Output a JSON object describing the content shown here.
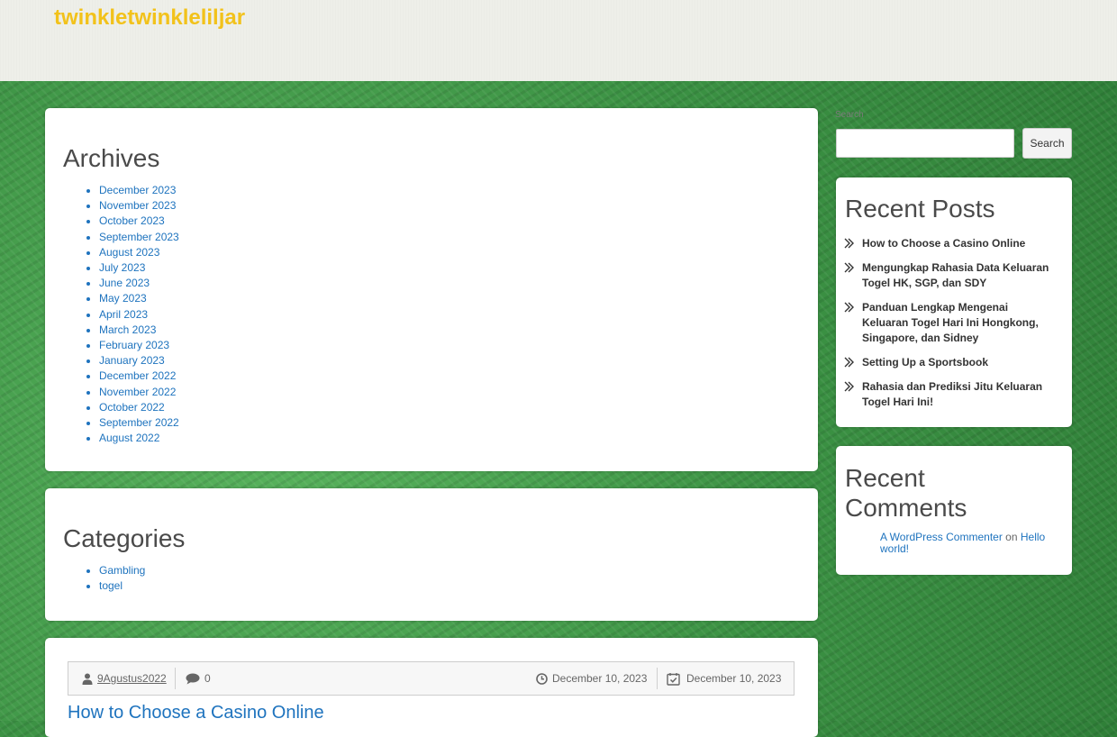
{
  "site": {
    "title": "twinkletwinkleliljar"
  },
  "archives": {
    "title": "Archives",
    "items": [
      "December 2023",
      "November 2023",
      "October 2023",
      "September 2023",
      "August 2023",
      "July 2023",
      "June 2023",
      "May 2023",
      "April 2023",
      "March 2023",
      "February 2023",
      "January 2023",
      "December 2022",
      "November 2022",
      "October 2022",
      "September 2022",
      "August 2022"
    ]
  },
  "categories": {
    "title": "Categories",
    "items": [
      "Gambling",
      "togel"
    ]
  },
  "search": {
    "label": "Search",
    "input_value": "",
    "button_label": "Search"
  },
  "recent_posts": {
    "title": "Recent Posts",
    "items": [
      "How to Choose a Casino Online",
      "Mengungkap Rahasia Data Keluaran Togel HK, SGP, dan SDY",
      "Panduan Lengkap Mengenai Keluaran Togel Hari Ini Hongkong, Singapore, dan Sidney",
      "Setting Up a Sportsbook",
      "Rahasia dan Prediksi Jitu Keluaran Togel Hari Ini!"
    ]
  },
  "recent_comments": {
    "title": "Recent Comments",
    "author": "A WordPress Commenter",
    "connector": "on",
    "post": "Hello world!"
  },
  "post": {
    "author": "9Agustus2022",
    "comments_count": "0",
    "published": "December 10, 2023",
    "updated": "December 10, 2023",
    "title": "How to Choose a Casino Online"
  },
  "colors": {
    "title": "#f2c21b",
    "link": "#1e73be",
    "background": "#3f9a47",
    "header": "#eeefe9"
  },
  "icons": [
    "user-icon",
    "comment-icon",
    "clock-icon",
    "calendar-check-icon",
    "double-arrow-icon"
  ]
}
